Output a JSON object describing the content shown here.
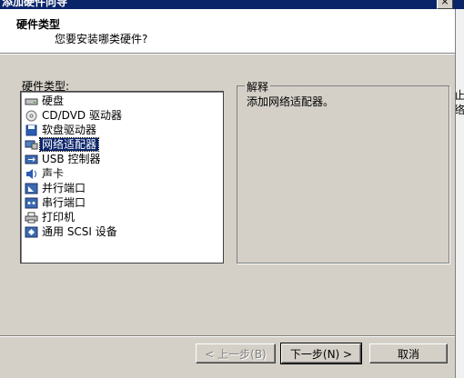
{
  "window": {
    "title": "添加硬件向导",
    "close_glyph": "×"
  },
  "header": {
    "title": "硬件类型",
    "subtitle": "您要安装哪类硬件?"
  },
  "right_strip": {
    "chars": [
      "止",
      "络"
    ]
  },
  "hardware_list": {
    "label": "硬件类型:",
    "items": [
      {
        "label": "硬盘",
        "icon": "hard-disk-icon"
      },
      {
        "label": "CD/DVD 驱动器",
        "icon": "cd-dvd-icon"
      },
      {
        "label": "软盘驱动器",
        "icon": "floppy-icon"
      },
      {
        "label": "网络适配器",
        "icon": "network-adapter-icon",
        "selected": true
      },
      {
        "label": "USB 控制器",
        "icon": "usb-icon"
      },
      {
        "label": "声卡",
        "icon": "sound-card-icon"
      },
      {
        "label": "并行端口",
        "icon": "parallel-port-icon"
      },
      {
        "label": "串行端口",
        "icon": "serial-port-icon"
      },
      {
        "label": "打印机",
        "icon": "printer-icon"
      },
      {
        "label": "通用 SCSI 设备",
        "icon": "scsi-icon"
      }
    ]
  },
  "explanation": {
    "legend": "解释",
    "text": "添加网络适配器。"
  },
  "buttons": {
    "back": "< 上一步(B)",
    "next": "下一步(N) >",
    "cancel": "取消"
  }
}
